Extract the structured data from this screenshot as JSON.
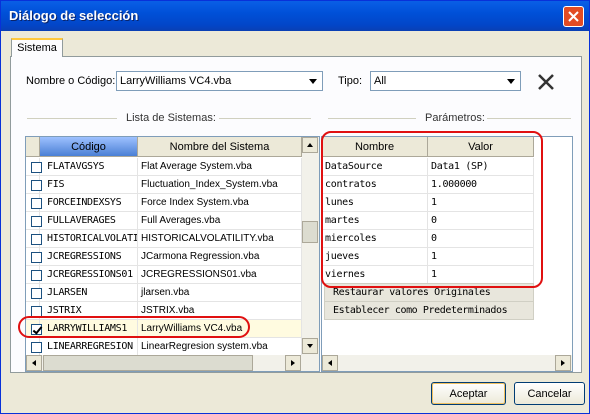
{
  "window": {
    "title": "Diálogo de selección"
  },
  "tab": {
    "label": "Sistema"
  },
  "filters": {
    "nombre_label": "Nombre o Código:",
    "nombre_value": "LarryWilliams VC4.vba",
    "tipo_label": "Tipo:",
    "tipo_value": "All"
  },
  "systems": {
    "title": "Lista de Sistemas:",
    "col_codigo": "Código",
    "col_nombre": "Nombre del Sistema",
    "rows": [
      {
        "codigo": "FLATAVGSYS",
        "nombre": "Flat Average System.vba",
        "checked": false
      },
      {
        "codigo": "FIS",
        "nombre": "Fluctuation_Index_System.vba",
        "checked": false
      },
      {
        "codigo": "FORCEINDEXSYS",
        "nombre": "Force Index System.vba",
        "checked": false
      },
      {
        "codigo": "FULLAVERAGES",
        "nombre": "Full Averages.vba",
        "checked": false
      },
      {
        "codigo": "HISTORICALVOLATI",
        "nombre": "HISTORICALVOLATILITY.vba",
        "checked": false
      },
      {
        "codigo": "JCREGRESSIONS",
        "nombre": "JCarmona Regression.vba",
        "checked": false
      },
      {
        "codigo": "JCREGRESSIONS01",
        "nombre": "JCREGRESSIONS01.vba",
        "checked": false
      },
      {
        "codigo": "JLARSEN",
        "nombre": "jlarsen.vba",
        "checked": false
      },
      {
        "codigo": "JSTRIX",
        "nombre": "JSTRIX.vba",
        "checked": false
      },
      {
        "codigo": "LARRYWILLIAMS1",
        "nombre": "LarryWilliams VC4.vba",
        "checked": true
      },
      {
        "codigo": "LINEARREGRESION",
        "nombre": "LinearRegresion system.vba",
        "checked": false
      }
    ]
  },
  "params": {
    "title": "Parámetros:",
    "col_nombre": "Nombre",
    "col_valor": "Valor",
    "rows": [
      {
        "nombre": "DataSource",
        "valor": "Data1 (SP)"
      },
      {
        "nombre": "contratos",
        "valor": "1.000000"
      },
      {
        "nombre": "lunes",
        "valor": "1"
      },
      {
        "nombre": "martes",
        "valor": "0"
      },
      {
        "nombre": "miercoles",
        "valor": "0"
      },
      {
        "nombre": "jueves",
        "valor": "1"
      },
      {
        "nombre": "viernes",
        "valor": "1"
      }
    ],
    "restore_label": "Restaurar valores Originales",
    "default_label": "Establecer como Predeterminados"
  },
  "buttons": {
    "ok": "Aceptar",
    "cancel": "Cancelar"
  },
  "colors": {
    "highlight": "#e01010",
    "titlebar": "#0050d8"
  }
}
